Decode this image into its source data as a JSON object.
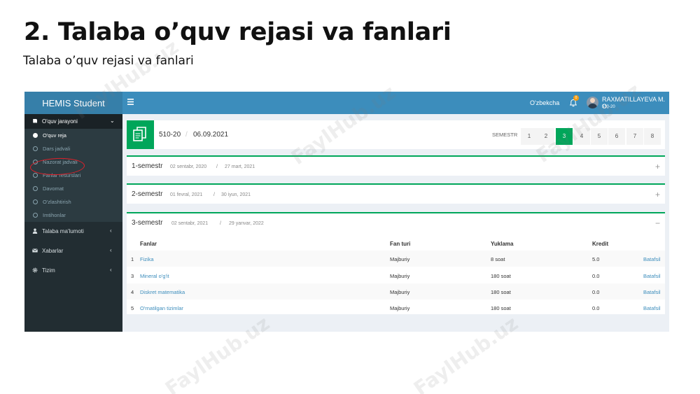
{
  "slide": {
    "title": "2. Talaba o’quv rejasi va fanlari",
    "subtitle": "Talaba o’quv rejasi va fanlari"
  },
  "watermark": "FaylHub.uz",
  "topbar": {
    "logo": "HEMIS Student",
    "menu_icon": "hamburger-icon",
    "language": "O'zbekcha",
    "notification_count": "0",
    "user_name": "RAXMATILLAYEVA M. O.",
    "user_group": "510-20"
  },
  "sidebar": {
    "group": {
      "label": "O'quv jarayoni",
      "icon": "book-icon"
    },
    "sub_items": [
      {
        "label": "O'quv reja",
        "active": true
      },
      {
        "label": "Dars jadvali",
        "active": false
      },
      {
        "label": "Nazorat jadvali",
        "active": false
      },
      {
        "label": "Fanlar resurslari",
        "active": false
      },
      {
        "label": "Davomat",
        "active": false
      },
      {
        "label": "O'zlashtirish",
        "active": false
      },
      {
        "label": "Imtihonlar",
        "active": false
      }
    ],
    "items": [
      {
        "label": "Talaba ma'lumoti",
        "icon": "user-icon"
      },
      {
        "label": "Xabarlar",
        "icon": "envelope-icon"
      },
      {
        "label": "Tizim",
        "icon": "gear-icon"
      }
    ]
  },
  "header": {
    "group_code": "510-20",
    "date": "06.09.2021",
    "semestr_label": "SEMESTR",
    "pages": [
      "1",
      "2",
      "3",
      "4",
      "5",
      "6",
      "7",
      "8"
    ],
    "active_page": "3"
  },
  "semesters": [
    {
      "title": "1-semestr",
      "start": "02 sentabr, 2020",
      "end": "27 mart, 2021",
      "toggle": "+"
    },
    {
      "title": "2-semestr",
      "start": "01 fevral, 2021",
      "end": "30 iyun, 2021",
      "toggle": "+"
    },
    {
      "title": "3-semestr",
      "start": "02 sentabr, 2021",
      "end": "29 yanvar, 2022",
      "toggle": "−"
    }
  ],
  "table": {
    "headers": [
      "Fanlar",
      "Fan turi",
      "Yuklama",
      "Kredit"
    ],
    "rows": [
      {
        "num": "1",
        "name": "Fizika",
        "type": "Majburiy",
        "load": "8 soat",
        "credit": "5.0",
        "action": "Batafsil"
      },
      {
        "num": "3",
        "name": "Mineral o'g'it",
        "type": "Majburiy",
        "load": "180 soat",
        "credit": "0.0",
        "action": "Batafsil"
      },
      {
        "num": "4",
        "name": "Diskret matematika",
        "type": "Majburiy",
        "load": "180 soat",
        "credit": "0.0",
        "action": "Batafsil"
      },
      {
        "num": "5",
        "name": "O'rnatilgan tizimlar",
        "type": "Majburiy",
        "load": "180 soat",
        "credit": "0.0",
        "action": "Batafsil"
      }
    ]
  },
  "colors": {
    "topbar": "#3c8dbc",
    "sidebar": "#222d32",
    "accent": "#00a65a",
    "annotation": "#e0202a"
  }
}
